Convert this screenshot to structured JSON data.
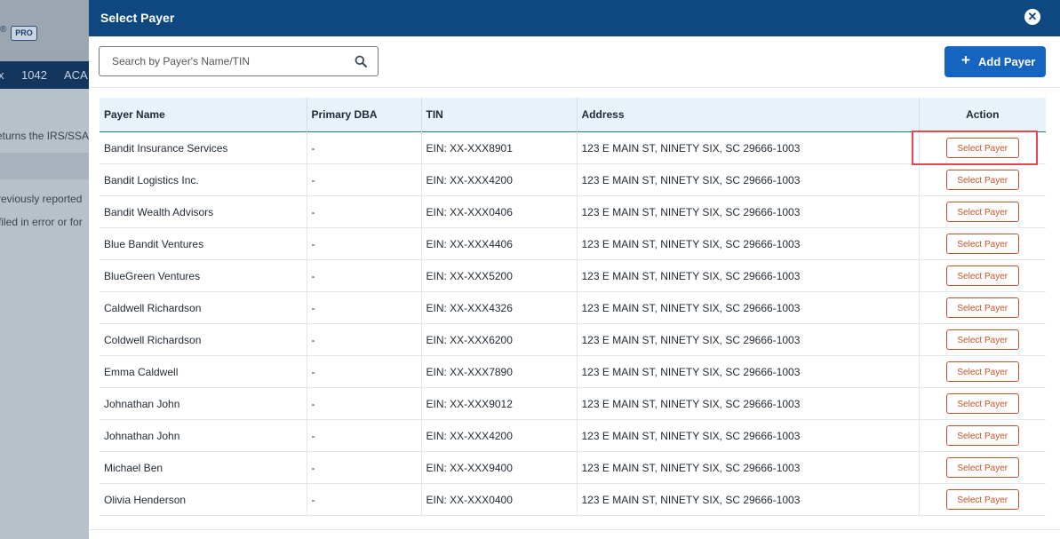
{
  "background": {
    "reg_mark": "®",
    "pro_badge": "PRO",
    "nav_items": [
      "x",
      "1042",
      "ACA"
    ],
    "text_lines": [
      "eturns the IRS/SSA",
      "reviously reported",
      "filed in error or for"
    ]
  },
  "modal": {
    "title": "Select Payer",
    "close_icon": "close-icon",
    "search": {
      "placeholder": "Search by Payer's Name/TIN",
      "value": ""
    },
    "add_button": {
      "icon": "plus",
      "label": "Add Payer"
    },
    "colors": {
      "header": "#0f4880",
      "accent": "#1565c0",
      "select_button": "#c7502a",
      "highlight": "#e3474f"
    },
    "table": {
      "columns": [
        "Payer Name",
        "Primary DBA",
        "TIN",
        "Address",
        "Action"
      ],
      "rows": [
        {
          "name": "Bandit Insurance Services",
          "dba": "-",
          "tin": "EIN: XX-XXX8901",
          "address": "123 E MAIN ST, NINETY SIX, SC 29666-1003",
          "action": "Select Payer"
        },
        {
          "name": "Bandit Logistics Inc.",
          "dba": "-",
          "tin": "EIN: XX-XXX4200",
          "address": "123 E MAIN ST, NINETY SIX, SC 29666-1003",
          "action": "Select Payer"
        },
        {
          "name": "Bandit Wealth Advisors",
          "dba": "-",
          "tin": "EIN: XX-XXX0406",
          "address": "123 E MAIN ST, NINETY SIX, SC 29666-1003",
          "action": "Select Payer"
        },
        {
          "name": "Blue Bandit Ventures",
          "dba": "-",
          "tin": "EIN: XX-XXX4406",
          "address": "123 E MAIN ST, NINETY SIX, SC 29666-1003",
          "action": "Select Payer"
        },
        {
          "name": "BlueGreen Ventures",
          "dba": "-",
          "tin": "EIN: XX-XXX5200",
          "address": "123 E MAIN ST, NINETY SIX, SC 29666-1003",
          "action": "Select Payer"
        },
        {
          "name": "Caldwell Richardson",
          "dba": "-",
          "tin": "EIN: XX-XXX4326",
          "address": "123 E MAIN ST, NINETY SIX, SC 29666-1003",
          "action": "Select Payer"
        },
        {
          "name": "Coldwell Richardson",
          "dba": "-",
          "tin": "EIN: XX-XXX6200",
          "address": "123 E MAIN ST, NINETY SIX, SC 29666-1003",
          "action": "Select Payer"
        },
        {
          "name": "Emma Caldwell",
          "dba": "-",
          "tin": "EIN: XX-XXX7890",
          "address": "123 E MAIN ST, NINETY SIX, SC 29666-1003",
          "action": "Select Payer"
        },
        {
          "name": "Johnathan John",
          "dba": "-",
          "tin": "EIN: XX-XXX9012",
          "address": "123 E MAIN ST, NINETY SIX, SC 29666-1003",
          "action": "Select Payer"
        },
        {
          "name": "Johnathan John",
          "dba": "-",
          "tin": "EIN: XX-XXX4200",
          "address": "123 E MAIN ST, NINETY SIX, SC 29666-1003",
          "action": "Select Payer"
        },
        {
          "name": "Michael Ben",
          "dba": "-",
          "tin": "EIN: XX-XXX9400",
          "address": "123 E MAIN ST, NINETY SIX, SC 29666-1003",
          "action": "Select Payer"
        },
        {
          "name": "Olivia Henderson",
          "dba": "-",
          "tin": "EIN: XX-XXX0400",
          "address": "123 E MAIN ST, NINETY SIX, SC 29666-1003",
          "action": "Select Payer"
        }
      ]
    }
  }
}
